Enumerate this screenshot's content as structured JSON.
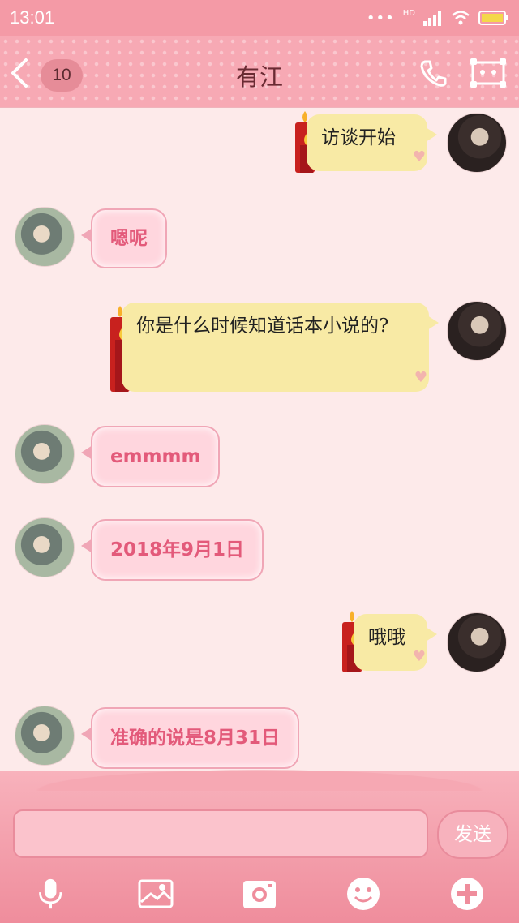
{
  "status_bar": {
    "time": "13:01",
    "network": "HD"
  },
  "header": {
    "unread_count": "10",
    "title": "有江"
  },
  "messages": [
    {
      "side": "right",
      "text": "访谈开始"
    },
    {
      "side": "left",
      "text": "嗯呢"
    },
    {
      "side": "right",
      "text": "你是什么时候知道话本小说的?"
    },
    {
      "side": "left",
      "text": "emmmm"
    },
    {
      "side": "left",
      "text": "2018年9月1日"
    },
    {
      "side": "right",
      "text": "哦哦"
    },
    {
      "side": "left",
      "text": "准确的说是8月31日"
    }
  ],
  "composer": {
    "send_label": "发送"
  },
  "colors": {
    "header": "#f7a9b4",
    "background": "#fdeaea",
    "incoming_text": "#e35a7a",
    "outgoing_bubble": "#f8eaa5"
  }
}
